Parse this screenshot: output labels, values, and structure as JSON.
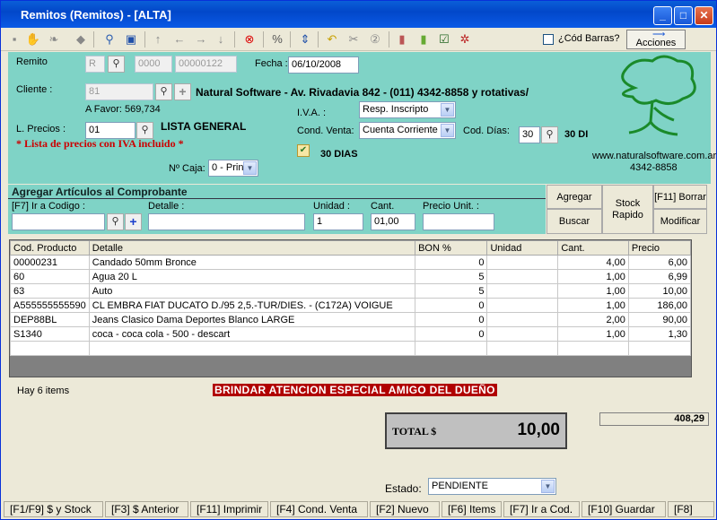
{
  "window": {
    "title": "Remitos  (Remitos) - [ALTA]"
  },
  "toolbar": {
    "cod_barras": "¿Cód Barras?",
    "acciones": "Acciones"
  },
  "header": {
    "remito_label": "Remito",
    "remito_type": "R",
    "remito_num1": "0000",
    "remito_num2": "00000122",
    "fecha_label": "Fecha :",
    "fecha": "06/10/2008",
    "cliente_label": "Cliente :",
    "cliente_code": "81",
    "cliente_desc": "Natural Software - Av. Rivadavia 842 - (011)  4342-8858   y rotativas/",
    "a_favor": "A Favor: 569,734",
    "lprecios_label": "L. Precios :",
    "lprecios_code": "01",
    "lprecios_name": "LISTA GENERAL",
    "iva_note": "* Lista de precios con IVA incluido *",
    "iva_label": "I.V.A. :",
    "iva_value": "Resp. Inscripto",
    "cond_label": "Cond. Venta:",
    "cond_value": "Cuenta Corriente",
    "dias_label": "Cod. Días:",
    "dias_code": "30",
    "dias_text": "30 DI",
    "dias_checkbox_text": "30 DIAS",
    "caja_label": "Nº Caja:",
    "caja_value": "0 - Prin",
    "website": "www.naturalsoftware.com.ar",
    "phone": "4342-8858"
  },
  "agregar": {
    "title": "Agregar Artículos al Comprobante",
    "codigo_label": "[F7] Ir a Codigo :",
    "detalle_label": "Detalle :",
    "unidad_label": "Unidad :",
    "unidad_value": "1",
    "cant_label": "Cant.",
    "cant_value": "01,00",
    "precio_label": "Precio Unit. :",
    "btn_agregar": "Agregar",
    "btn_buscar": "Buscar",
    "btn_stock": "Stock Rapido",
    "btn_borrar": "[F11] Borrar",
    "btn_modificar": "Modificar"
  },
  "table": {
    "headers": [
      "Cod. Producto",
      "Detalle",
      "BON %",
      "Unidad",
      "Cant.",
      "Precio"
    ],
    "rows": [
      [
        "00000231",
        "Candado 50mm Bronce",
        "0",
        "",
        "4,00",
        "6,00"
      ],
      [
        "60",
        "Agua 20 L",
        "5",
        "",
        "1,00",
        "6,99"
      ],
      [
        "63",
        "Auto",
        "5",
        "",
        "1,00",
        "10,00"
      ],
      [
        "A555555555590",
        "CL EMBRA FIAT DUCATO D./95 2,5.-TUR/DIES. - (C172A) VOIGUE",
        "0",
        "",
        "1,00",
        "186,00"
      ],
      [
        "DEP88BL",
        "Jeans Clasico Dama Deportes Blanco LARGE",
        "0",
        "",
        "2,00",
        "90,00"
      ],
      [
        "S1340",
        "coca - coca cola - 500 - descart",
        "0",
        "",
        "1,00",
        "1,30"
      ]
    ]
  },
  "footer": {
    "items_count": "Hay 6 items",
    "banner": "BRINDAR ATENCION ESPECIAL AMIGO DEL DUEÑO",
    "total_label": "TOTAL $",
    "total_value": "10,00",
    "side_value": "408,29",
    "estado_label": "Estado:",
    "estado_value": "PENDIENTE"
  },
  "statusbar": [
    "[F1/F9] $ y Stock",
    "[F3] $ Anterior",
    "[F11] Imprimir",
    "[F4] Cond. Venta",
    "[F2] Nuevo",
    "[F6] Items",
    "[F7] Ir a Cod.",
    "[F10] Guardar",
    "[F8]"
  ],
  "colors": {
    "panel": "#7fd3c6",
    "titlebar": "#0a5fd8",
    "banner": "#b00000",
    "note_red": "#cc0000"
  }
}
